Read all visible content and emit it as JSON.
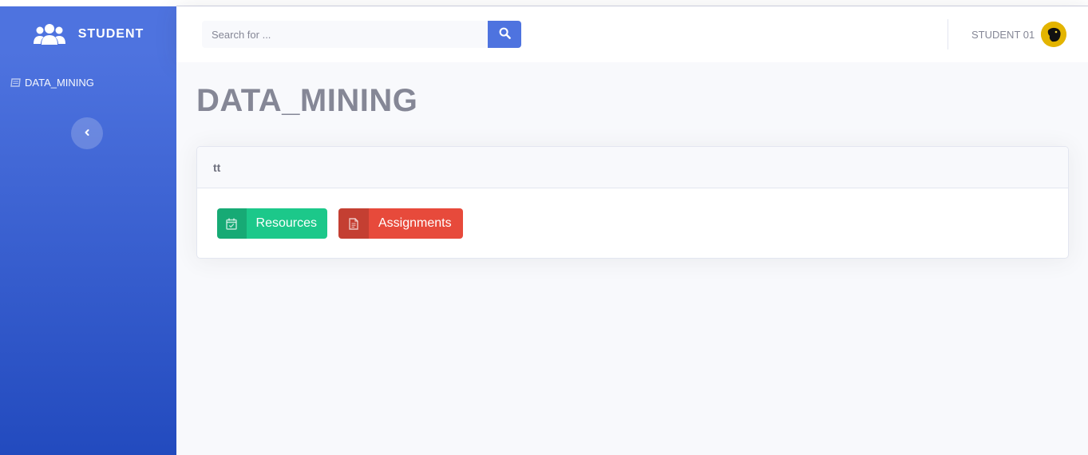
{
  "sidebar": {
    "brand": "STUDENT",
    "nav_item": "DATA_MINING"
  },
  "topbar": {
    "search_placeholder": "Search for ...",
    "user_name": "STUDENT 01"
  },
  "main": {
    "page_title": "DATA_MINING",
    "card_title": "tt",
    "resources_label": "Resources",
    "assignments_label": "Assignments"
  },
  "colors": {
    "primary": "#4e73df",
    "success": "#1cc88a",
    "danger": "#e74a3b",
    "text_muted": "#858796"
  },
  "icons": {
    "brand": "users-icon",
    "nav": "book-icon",
    "toggle": "chevron-left-icon",
    "search": "search-icon",
    "resources": "calendar-check-icon",
    "assignments": "file-alt-icon"
  }
}
